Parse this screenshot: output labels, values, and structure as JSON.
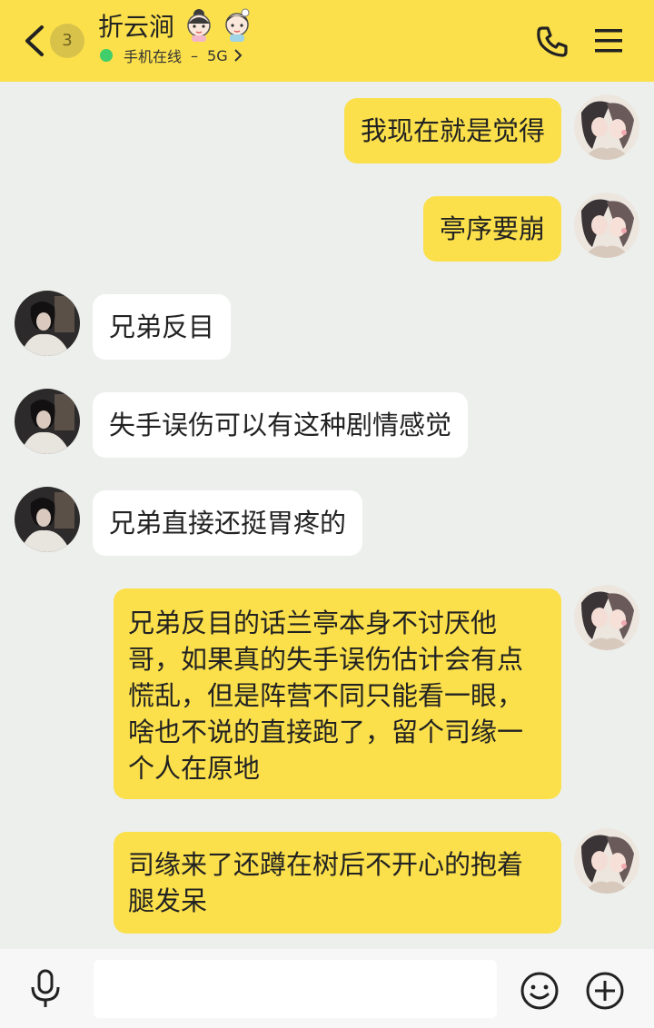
{
  "header": {
    "unread_count": "3",
    "contact_name": "折云涧",
    "status_text": "手机在线",
    "separator": "–",
    "network": "5G"
  },
  "messages": [
    {
      "side": "mine",
      "text": "我现在就是觉得"
    },
    {
      "side": "mine",
      "text": "亭序要崩"
    },
    {
      "side": "theirs",
      "text": "兄弟反目"
    },
    {
      "side": "theirs",
      "text": "失手误伤可以有这种剧情感觉"
    },
    {
      "side": "theirs",
      "text": "兄弟直接还挺胃疼的"
    },
    {
      "side": "mine",
      "text": "兄弟反目的话兰亭本身不讨厌他哥，如果真的失手误伤估计会有点慌乱，但是阵营不同只能看一眼，啥也不说的直接跑了，留个司缘一个人在原地"
    },
    {
      "side": "mine",
      "text": "司缘来了还蹲在树后不开心的抱着腿发呆"
    }
  ],
  "input": {
    "value": "",
    "placeholder": ""
  },
  "colors": {
    "accent_yellow": "#fbe04b",
    "background": "#ecefec",
    "online_green": "#3fce6a"
  }
}
